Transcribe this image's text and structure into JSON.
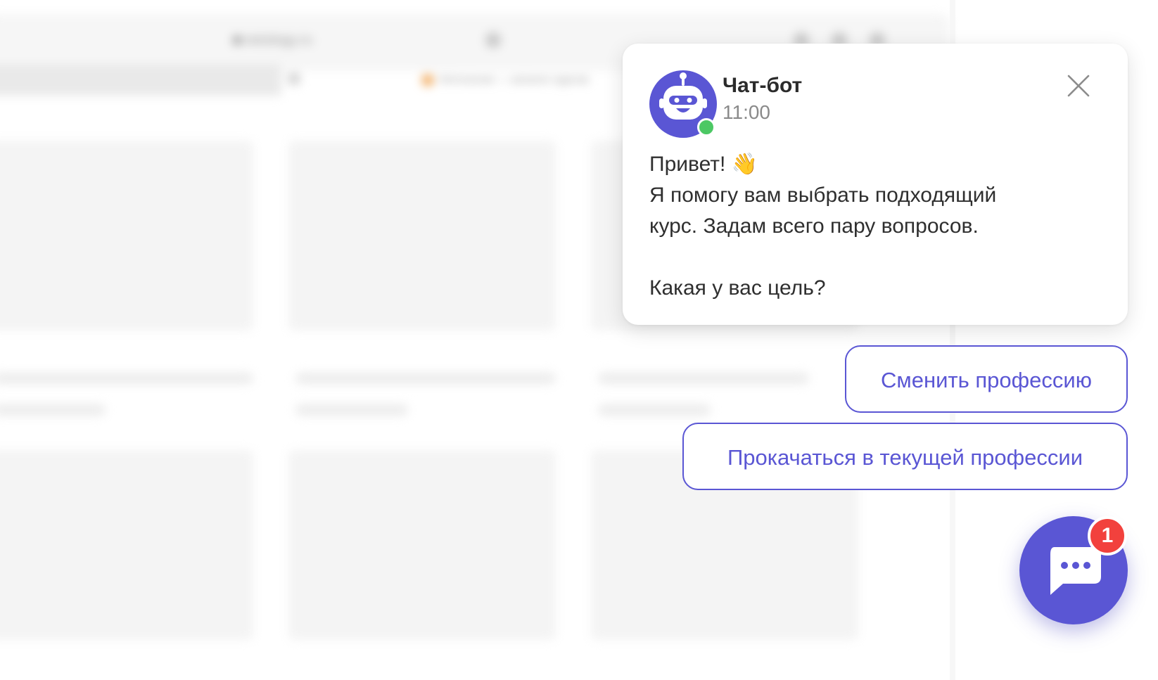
{
  "background": {
    "address_bar_text": "a.netology.ru",
    "tab_title": "Нетология — каталог курсов"
  },
  "chat": {
    "bot_name": "Чат-бот",
    "time": "11:00",
    "greeting": "Привет! 👋",
    "intro_line1": "Я помогу вам выбрать подходящий",
    "intro_line2": "курс. Задам всего пару вопросов.",
    "question": "Какая у вас цель?",
    "online": true
  },
  "quick_replies": [
    {
      "label": "Сменить профессию"
    },
    {
      "label": "Прокачаться в текущей профессии"
    }
  ],
  "launcher": {
    "unread_count": "1"
  },
  "colors": {
    "accent": "#5a56d4",
    "badge": "#f2413d",
    "online": "#4cc864"
  },
  "icons": {
    "avatar": "robot-icon",
    "close": "close-icon",
    "launcher": "chat-bubble-icon"
  }
}
